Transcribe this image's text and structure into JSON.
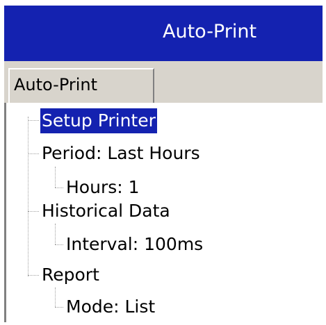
{
  "window": {
    "title": "Auto-Print"
  },
  "tabs": [
    {
      "label": "Auto-Print"
    }
  ],
  "tree": {
    "setup_printer": "Setup Printer",
    "period": "Period: Last Hours",
    "hours": "Hours: 1",
    "historical_data": "Historical Data",
    "interval": "Interval: 100ms",
    "report": "Report",
    "mode": "Mode: List"
  },
  "colors": {
    "titlebar": "#1422b0",
    "selection": "#1422b0",
    "tabstrip": "#d8d4cc"
  }
}
